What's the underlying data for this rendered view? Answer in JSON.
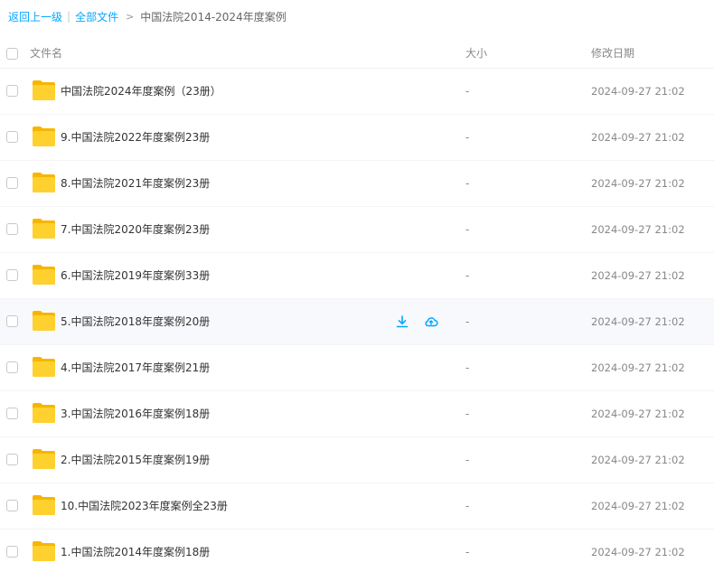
{
  "breadcrumb": {
    "back": "返回上一级",
    "sep": "|",
    "all_files": "全部文件",
    "gt": ">",
    "current": "中国法院2014-2024年度案例"
  },
  "header": {
    "name": "文件名",
    "size": "大小",
    "modified": "修改日期"
  },
  "icons": {
    "folder": "folder-icon",
    "download": "download-icon",
    "save_to_cloud": "cloud-upload-icon"
  },
  "colors": {
    "accent": "#06a7ff",
    "folder_front": "#ffd12e",
    "folder_back": "#f7b500",
    "row_hover": "#f7f9fc"
  },
  "rows": [
    {
      "name": "中国法院2024年度案例（23册）",
      "size": "-",
      "modified": "2024-09-27 21:02"
    },
    {
      "name": "9.中国法院2022年度案例23册",
      "size": "-",
      "modified": "2024-09-27 21:02"
    },
    {
      "name": "8.中国法院2021年度案例23册",
      "size": "-",
      "modified": "2024-09-27 21:02"
    },
    {
      "name": "7.中国法院2020年度案例23册",
      "size": "-",
      "modified": "2024-09-27 21:02"
    },
    {
      "name": "6.中国法院2019年度案例33册",
      "size": "-",
      "modified": "2024-09-27 21:02"
    },
    {
      "name": "5.中国法院2018年度案例20册",
      "size": "-",
      "modified": "2024-09-27 21:02"
    },
    {
      "name": "4.中国法院2017年度案例21册",
      "size": "-",
      "modified": "2024-09-27 21:02"
    },
    {
      "name": "3.中国法院2016年度案例18册",
      "size": "-",
      "modified": "2024-09-27 21:02"
    },
    {
      "name": "2.中国法院2015年度案例19册",
      "size": "-",
      "modified": "2024-09-27 21:02"
    },
    {
      "name": "10.中国法院2023年度案例全23册",
      "size": "-",
      "modified": "2024-09-27 21:02"
    },
    {
      "name": "1.中国法院2014年度案例18册",
      "size": "-",
      "modified": "2024-09-27 21:02"
    }
  ]
}
